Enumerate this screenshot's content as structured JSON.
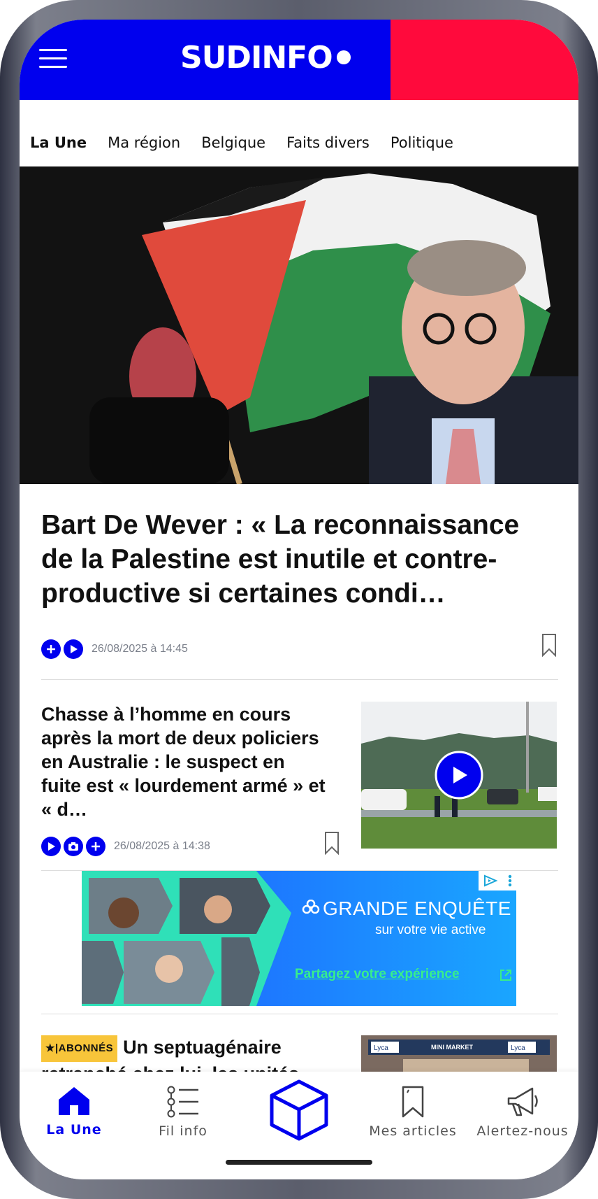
{
  "brand": {
    "logo_text": "SUDINFO",
    "color_blue": "#0000ee",
    "color_red": "#ff0a3c"
  },
  "tabs": [
    {
      "label": "La Une",
      "active": true
    },
    {
      "label": "Ma région",
      "active": false
    },
    {
      "label": "Belgique",
      "active": false
    },
    {
      "label": "Faits divers",
      "active": false
    },
    {
      "label": "Politique",
      "active": false
    }
  ],
  "articles": [
    {
      "title": "Bart De Wever : « La reconnaissance de la Palestine est inutile et contre-productive si certaines condi…",
      "timestamp": "26/08/2025 à 14:45",
      "badges": [
        "plus-icon",
        "play-icon"
      ]
    },
    {
      "title": "Chasse à l’homme en cours après la mort de deux policiers en Australie : le suspect en fuite est « lourdement armé » et « d…",
      "timestamp": "26/08/2025 à 14:38",
      "badges": [
        "play-icon",
        "camera-icon",
        "plus-icon"
      ]
    },
    {
      "badge": "★|ABONNÉS",
      "title": "Un septuagénaire retranché chez lui, les unités"
    }
  ],
  "ad": {
    "title": "GRANDE ENQUÊTE",
    "subtitle": "sur votre vie active",
    "cta": "Partagez votre expérience"
  },
  "thumb3_sign": {
    "left": "Lyca",
    "center": "MINI MARKET",
    "right": "Lyca"
  },
  "bottom_nav": [
    {
      "label": "La Une",
      "icon": "home-icon",
      "active": true
    },
    {
      "label": "Fil info",
      "icon": "list-icon",
      "active": false
    },
    {
      "label": "",
      "icon": "cube-icon",
      "active": false
    },
    {
      "label": "Mes articles",
      "icon": "bookmark-icon",
      "active": false
    },
    {
      "label": "Alertez-nous",
      "icon": "megaphone-icon",
      "active": false
    }
  ]
}
